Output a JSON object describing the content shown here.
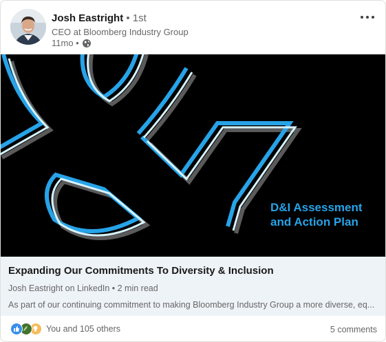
{
  "post": {
    "author": {
      "name": "Josh Eastright",
      "degree": "• 1st",
      "headline": "CEO at Bloomberg Industry Group",
      "time": "11mo •",
      "visibility_icon": "globe-icon",
      "avatar_icon": "avatar"
    },
    "more_icon": "more-options-icon"
  },
  "banner": {
    "title_line1": "D&I Assessment",
    "title_line2": "and Action Plan",
    "colors": {
      "background": "#000000",
      "accent": "#27a3e8",
      "outline_light": "#d7f3ff",
      "shadow": "#5a5a5a"
    }
  },
  "article": {
    "title": "Expanding Our Commitments To Diversity & Inclusion",
    "source": "Josh Eastright on LinkedIn • 2 min read",
    "description": "As part of our continuing commitment to making Bloomberg Industry Group a more diverse, eq..."
  },
  "social": {
    "reaction_icons": [
      "like-icon",
      "celebrate-icon",
      "insightful-icon"
    ],
    "reactions_text": "You and 105 others",
    "comments_text": "5 comments"
  }
}
